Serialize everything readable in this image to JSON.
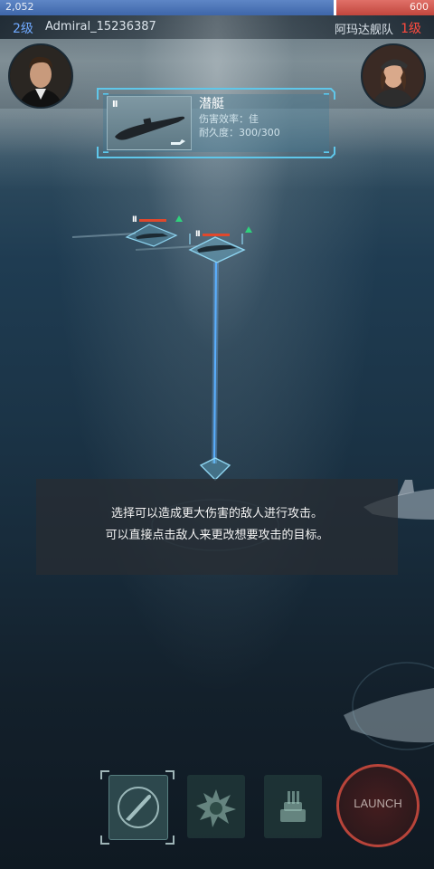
{
  "hud": {
    "hp_left": "2,052",
    "hp_right": "600",
    "hp_blue_fraction": 0.77,
    "player_level": "2级",
    "player_name": "Admiral_15236387",
    "enemy_name": "阿玛达舰队",
    "enemy_level": "1级"
  },
  "target_card": {
    "pause_mark": "II",
    "title": "潜艇",
    "damage_line": "伤害效率：佳",
    "durability_line": "耐久度：300/300"
  },
  "markers": [
    {
      "pause": "II"
    },
    {
      "pause": "II"
    }
  ],
  "tip": {
    "line1": "选择可以造成更大伤害的敌人进行攻击。",
    "line2": "可以直接点击敌人来更改想要攻击的目标。"
  },
  "actions": {
    "launch_label": "LAUNCH"
  },
  "colors": {
    "player_blue": "#4a72b4",
    "enemy_red": "#cd5248",
    "player_level": "#6fa9ff",
    "enemy_level": "#ff4b3e",
    "target_line": "#4aa8ff"
  }
}
